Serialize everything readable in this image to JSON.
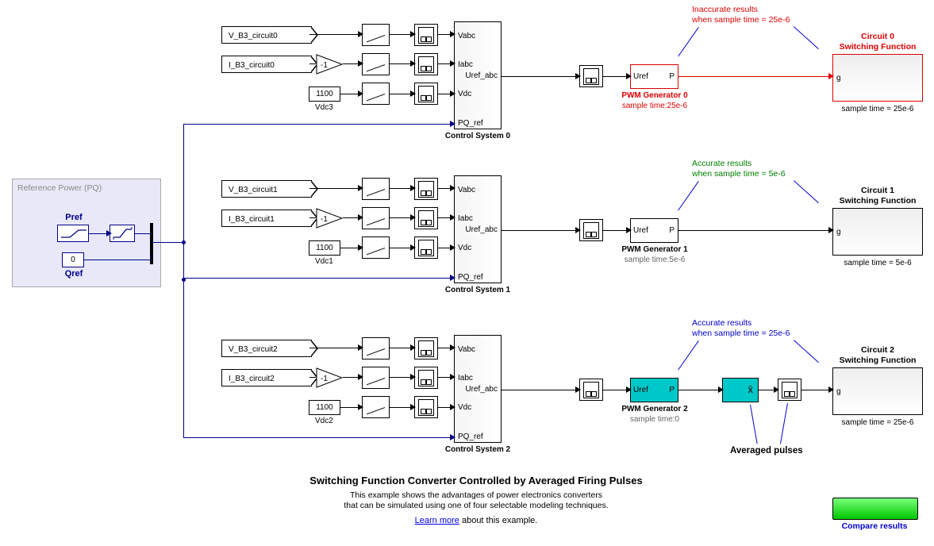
{
  "refPower": {
    "title": "Reference Power (PQ)",
    "pref": "Pref",
    "qref": "Qref",
    "qrefVal": "0"
  },
  "rows": [
    {
      "vtag": "V_B3_circuit0",
      "itag": "I_B3_circuit0",
      "gain": "-1",
      "constVal": "1100",
      "vdcLabel": "Vdc3",
      "ctrlLabel": "Control System 0",
      "ports": {
        "p1": "Vabc",
        "p2": "Iabc",
        "p3": "Vdc",
        "p4": "PQ_ref",
        "out": "Uref_abc"
      },
      "pwmLabel": "PWM Generator 0",
      "pwmSample": "sample time:25e-6",
      "pwmIn": "Uref",
      "pwmOut": "P",
      "circuitTitle1": "Circuit 0",
      "circuitTitle2": "Switching Function",
      "circuitSample": "sample time = 25e-6",
      "circuitPort": "g",
      "annotColor": "red",
      "annot1": "Inaccurate results",
      "annot2": "when sample time = 25e-6"
    },
    {
      "vtag": "V_B3_circuit1",
      "itag": "I_B3_circuit1",
      "gain": "-1",
      "constVal": "1100",
      "vdcLabel": "Vdc1",
      "ctrlLabel": "Control System 1",
      "ports": {
        "p1": "Vabc",
        "p2": "Iabc",
        "p3": "Vdc",
        "p4": "PQ_ref",
        "out": "Uref_abc"
      },
      "pwmLabel": "PWM Generator 1",
      "pwmSample": "sample time:5e-6",
      "pwmIn": "Uref",
      "pwmOut": "P",
      "circuitTitle1": "Circuit 1",
      "circuitTitle2": "Switching Function",
      "circuitSample": "sample time = 5e-6",
      "circuitPort": "g",
      "annotColor": "green",
      "annot1": "Accurate results",
      "annot2": "when sample time = 5e-6"
    },
    {
      "vtag": "V_B3_circuit2",
      "itag": "I_B3_circuit2",
      "gain": "-1",
      "constVal": "1100",
      "vdcLabel": "Vdc2",
      "ctrlLabel": "Control System 2",
      "ports": {
        "p1": "Vabc",
        "p2": "Iabc",
        "p3": "Vdc",
        "p4": "PQ_ref",
        "out": "Uref_abc"
      },
      "pwmLabel": "PWM Generator 2",
      "pwmSample": "sample time:0",
      "pwmIn": "Uref",
      "pwmOut": "P",
      "circuitTitle1": "Circuit 2",
      "circuitTitle2": "Switching Function",
      "circuitSample": "sample time = 25e-6",
      "circuitPort": "g",
      "annotColor": "blue",
      "annot1": "Accurate results",
      "annot2": "when sample time = 25e-6",
      "avgLabel": "Averaged pulses",
      "meanSym": "x̄"
    }
  ],
  "footer": {
    "title": "Switching Function Converter Controlled by Averaged Firing Pulses",
    "line1": "This example shows the advantages of power electronics converters",
    "line2": "that can be simulated using one of four selectable modeling techniques.",
    "learn": "Learn more",
    "learnRest": " about this example."
  },
  "compare": "Compare results"
}
